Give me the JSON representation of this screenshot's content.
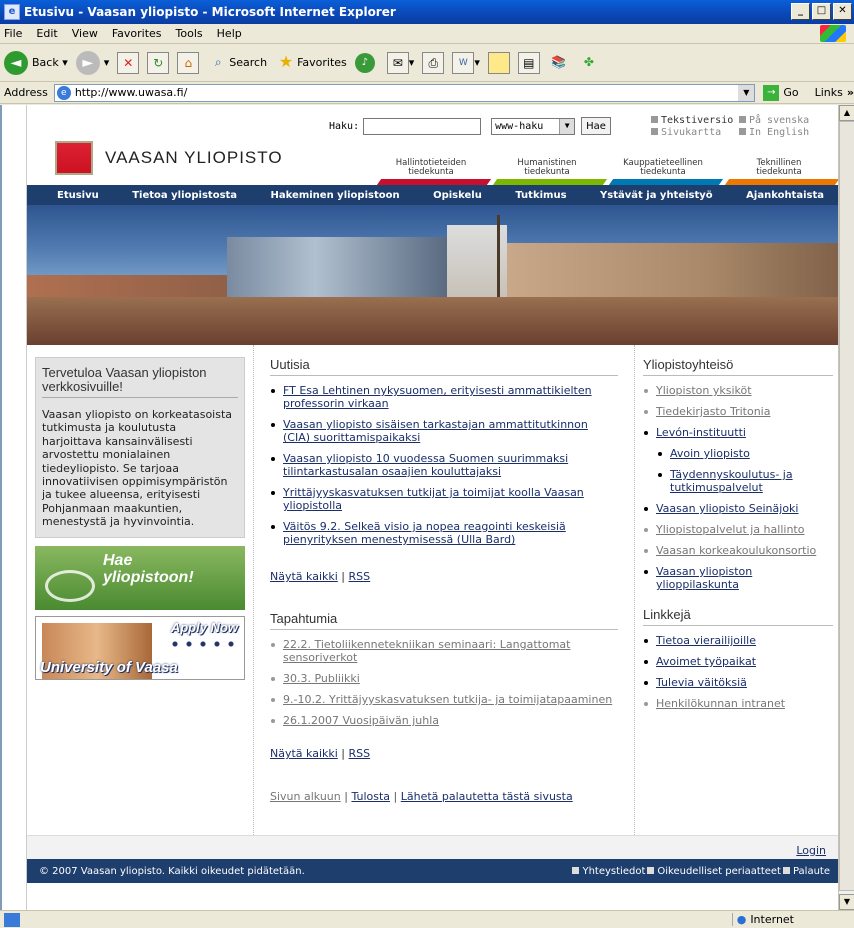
{
  "window": {
    "title": "Etusivu - Vaasan yliopisto - Microsoft Internet Explorer"
  },
  "menu": [
    "File",
    "Edit",
    "View",
    "Favorites",
    "Tools",
    "Help"
  ],
  "toolbar": {
    "back": "Back",
    "search": "Search",
    "favorites": "Favorites"
  },
  "address": {
    "label": "Address",
    "url": "http://www.uwasa.fi/",
    "go": "Go",
    "links": "Links"
  },
  "site": {
    "logo": "VAASAN YLIOPISTO",
    "search_label": "Haku:",
    "search_select": "www-haku",
    "search_button": "Hae",
    "toplinks": [
      {
        "label": "Tekstiversio",
        "dim": false
      },
      {
        "label": "På svenska",
        "dim": true
      },
      {
        "label": "Sivukartta",
        "dim": true
      },
      {
        "label": "In English",
        "dim": true
      }
    ],
    "faculties": [
      {
        "l1": "Hallintotieteiden",
        "l2": "tiedekunta",
        "color": "#c8102e"
      },
      {
        "l1": "Humanistinen",
        "l2": "tiedekunta",
        "color": "#7cb800"
      },
      {
        "l1": "Kauppatieteellinen",
        "l2": "tiedekunta",
        "color": "#0078b4"
      },
      {
        "l1": "Teknillinen",
        "l2": "tiedekunta",
        "color": "#ee7700"
      }
    ],
    "nav": [
      "Etusivu",
      "Tietoa yliopistosta",
      "Hakeminen yliopistoon",
      "Opiskelu",
      "Tutkimus",
      "Ystävät ja yhteistyö",
      "Ajankohtaista"
    ],
    "welcome": {
      "title": "Tervetuloa Vaasan yliopiston verkkosivuille!",
      "text": "Vaasan yliopisto on korkeatasoista tutkimusta ja koulutusta harjoittava kansainvälisesti arvostettu monialainen tiedeyliopisto. Se tarjoaa innovatiivisen oppimisympäristön ja tukee alueensa, erityisesti Pohjanmaan maakuntien, menestystä ja hyvinvointia."
    },
    "banner1": {
      "l1": "Hae",
      "l2": "yliopistoon!"
    },
    "banner2": {
      "l1": "Apply Now",
      "l2": "University of Vaasa"
    },
    "news": {
      "title": "Uutisia",
      "items": [
        "FT Esa Lehtinen nykysuomen, erityisesti ammattikielten professorin virkaan",
        "Vaasan yliopisto sisäisen tarkastajan ammattitutkinnon (CIA) suorittamispaikaksi",
        "Vaasan yliopisto 10 vuodessa Suomen suurimmaksi tilintarkastusalan osaajien kouluttajaksi",
        "Yrittäjyyskasvatuksen tutkijat ja toimijat koolla Vaasan yliopistolla",
        "Väitös 9.2. Selkeä visio ja nopea reagointi keskeisiä pienyrityksen menestymisessä (Ulla Bard)"
      ],
      "show_all": "Näytä kaikki",
      "rss": "RSS"
    },
    "events": {
      "title": "Tapahtumia",
      "items": [
        "22.2. Tietoliikennetekniikan seminaari: Langattomat sensoriverkot",
        "30.3. Publiikki",
        "9.-10.2. Yrittäjyyskasvatuksen tutkija- ja toimijatapaaminen",
        "26.1.2007 Vuosipäivän juhla"
      ],
      "show_all": "Näytä kaikki",
      "rss": "RSS"
    },
    "page_links": [
      "Sivun alkuun",
      "Tulosta",
      "Lähetä palautetta tästä sivusta"
    ],
    "community": {
      "title": "Yliopistoyhteisö",
      "items": [
        {
          "label": "Yliopiston yksiköt",
          "grey": true
        },
        {
          "label": "Tiedekirjasto Tritonia",
          "grey": true
        },
        {
          "label": "Levón-instituutti",
          "grey": false
        },
        {
          "label": "Avoin yliopisto",
          "grey": false,
          "sub": true
        },
        {
          "label": "Täydennyskoulutus- ja tutkimuspalvelut",
          "grey": false,
          "sub": true
        },
        {
          "label": "Vaasan yliopisto Seinäjoki",
          "grey": false
        },
        {
          "label": "Yliopistopalvelut ja hallinto",
          "grey": true
        },
        {
          "label": "Vaasan korkeakoulukonsortio",
          "grey": true
        },
        {
          "label": "Vaasan yliopiston ylioppilaskunta",
          "grey": false
        }
      ]
    },
    "links": {
      "title": "Linkkejä",
      "items": [
        {
          "label": "Tietoa vierailijoille",
          "grey": false
        },
        {
          "label": "Avoimet työpaikat",
          "grey": false
        },
        {
          "label": "Tulevia väitöksiä",
          "grey": false
        },
        {
          "label": "Henkilökunnan intranet",
          "grey": true
        }
      ]
    },
    "login": "Login",
    "copyright": "© 2007 Vaasan yliopisto. Kaikki oikeudet pidätetään.",
    "footer_links": [
      "Yhteystiedot",
      "Oikeudelliset periaatteet",
      "Palaute"
    ]
  },
  "status": {
    "zone": "Internet"
  }
}
